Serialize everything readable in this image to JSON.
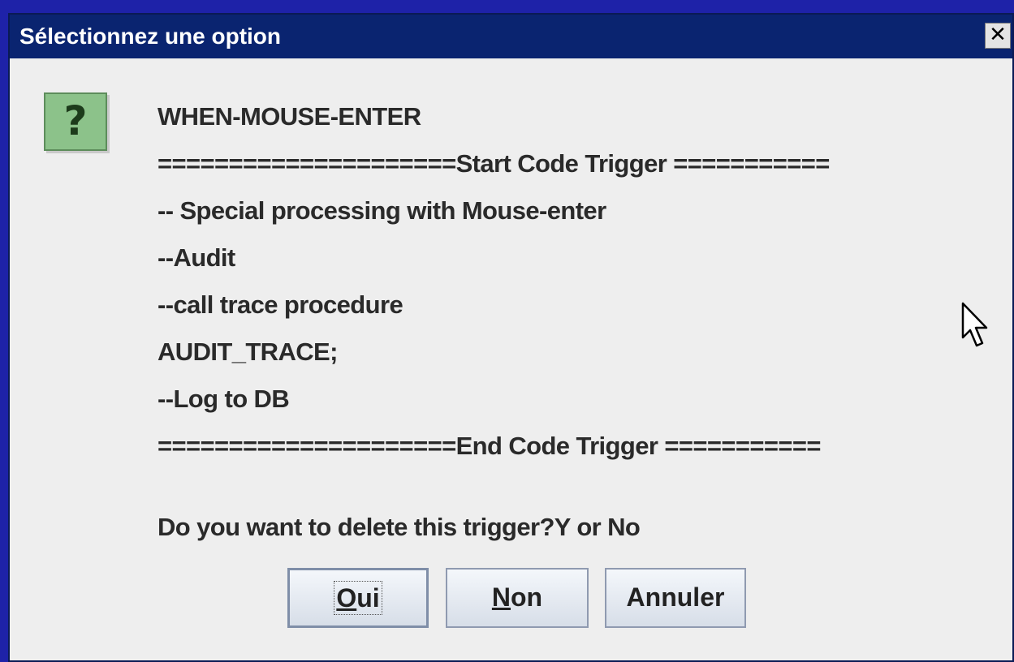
{
  "dialog": {
    "title": "Sélectionnez une option",
    "close_label": "✕"
  },
  "icon": {
    "name": "question-icon",
    "glyph": "?"
  },
  "message": {
    "lines": [
      "WHEN-MOUSE-ENTER",
      "=====================Start Code Trigger ===========",
      "-- Special processing with Mouse-enter",
      "--Audit",
      "--call trace procedure",
      "AUDIT_TRACE;",
      "--Log to DB",
      "=====================End Code Trigger ==========="
    ],
    "question": "Do you want to delete this trigger?Y or No"
  },
  "buttons": {
    "yes": {
      "mnemonic": "O",
      "rest": "ui"
    },
    "no": {
      "mnemonic": "N",
      "rest": "on"
    },
    "cancel": {
      "label": "Annuler"
    }
  },
  "colors": {
    "title_bar": "#0a2470",
    "dialog_bg": "#eeeeee",
    "desktop": "#1e22a8",
    "icon_bg": "#8cc28a"
  }
}
